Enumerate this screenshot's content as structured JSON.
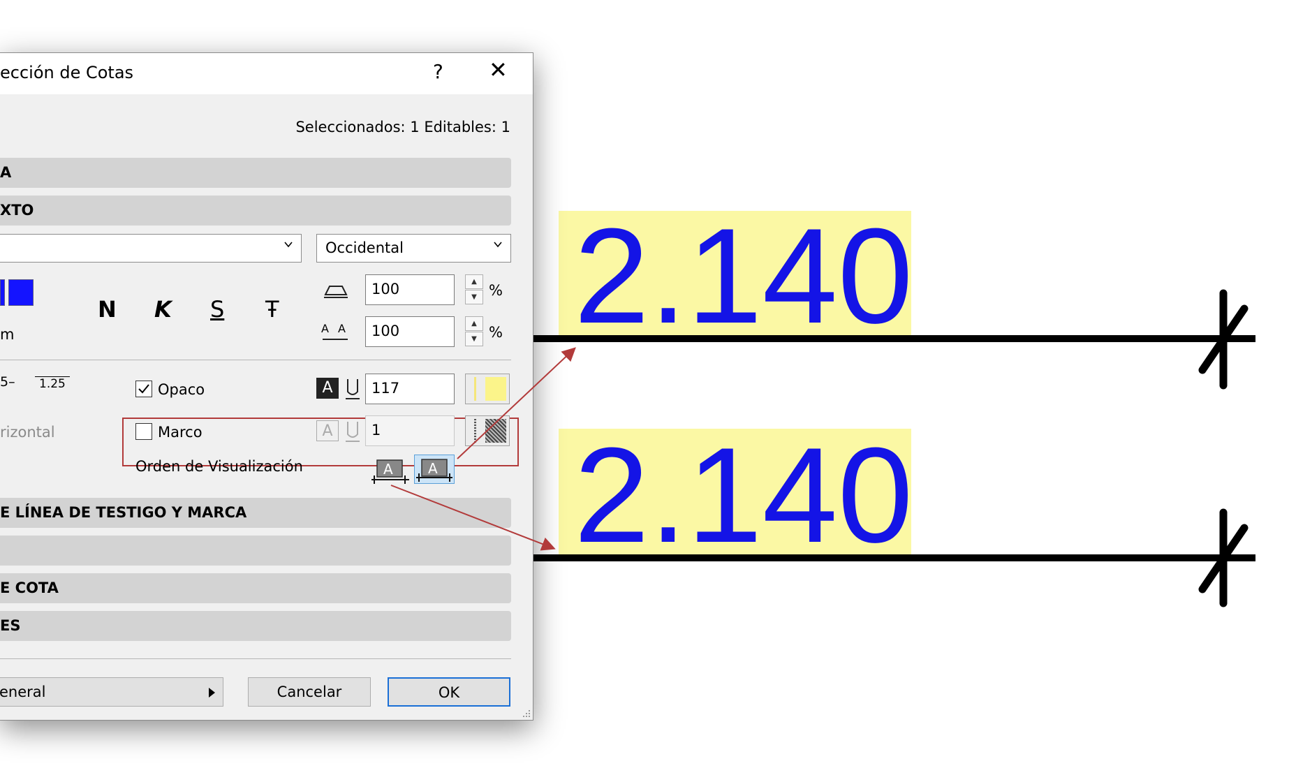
{
  "dialog": {
    "title": "ección de Cotas",
    "help": "?",
    "close": "✕",
    "selection_info": "Seleccionados: 1 Editables: 1"
  },
  "sections": {
    "s1": "A",
    "s2": "XTO",
    "s3": "E LÍNEA DE TESTIGO Y MARCA",
    "s4": "",
    "s5": "E COTA",
    "s6": "ES"
  },
  "text_panel": {
    "font_combo": "",
    "script_combo": "Occidental",
    "width_value": "100",
    "spacing_value": "100",
    "percent": "%",
    "format_bold": "N",
    "format_italic": "K",
    "format_underline": "S",
    "format_strike": "Ŧ",
    "unit_label": "m",
    "fraction_left": "5–",
    "fraction_right": "1.25",
    "horizontal_label": "rizontal",
    "opaque_label": "Opaco",
    "opaque_checked": true,
    "opaque_pen": "117",
    "frame_label": "Marco",
    "frame_checked": false,
    "frame_pen": "1",
    "order_label": "Orden de Visualización"
  },
  "buttons": {
    "general": "eneral",
    "cancel": "Cancelar",
    "ok": "OK"
  },
  "drawing": {
    "dim_top": "2.140",
    "dim_bottom": "2.140",
    "text_color": "#1414e6",
    "background_color": "#fbf8a4",
    "annotation_color": "#b23a3a"
  }
}
